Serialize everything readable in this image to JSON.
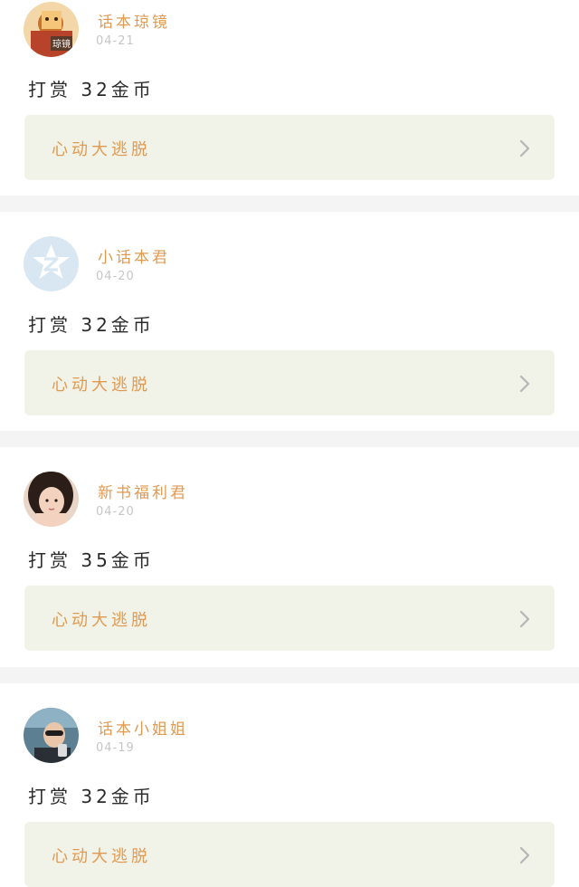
{
  "posts": [
    {
      "username": "话本琼镜",
      "date": "04-21",
      "reward": "打赏 32金币",
      "book_title": "心动大逃脱",
      "avatar_icon": "cartoon-character-avatar-icon",
      "avatar_badge": "琼镜"
    },
    {
      "username": "小话本君",
      "date": "04-20",
      "reward": "打赏 32金币",
      "book_title": "心动大逃脱",
      "avatar_icon": "default-star-avatar-icon"
    },
    {
      "username": "新书福利君",
      "date": "04-20",
      "reward": "打赏 35金币",
      "book_title": "心动大逃脱",
      "avatar_icon": "girl-photo-avatar-icon"
    },
    {
      "username": "话本小姐姐",
      "date": "04-19",
      "reward": "打赏 32金币",
      "book_title": "心动大逃脱",
      "avatar_icon": "person-photo-avatar-icon"
    }
  ],
  "colors": {
    "accent": "#e09a52",
    "card_bg": "#f1f3e9",
    "separator": "#f4f4f4",
    "date_text": "#c6c6c6"
  }
}
